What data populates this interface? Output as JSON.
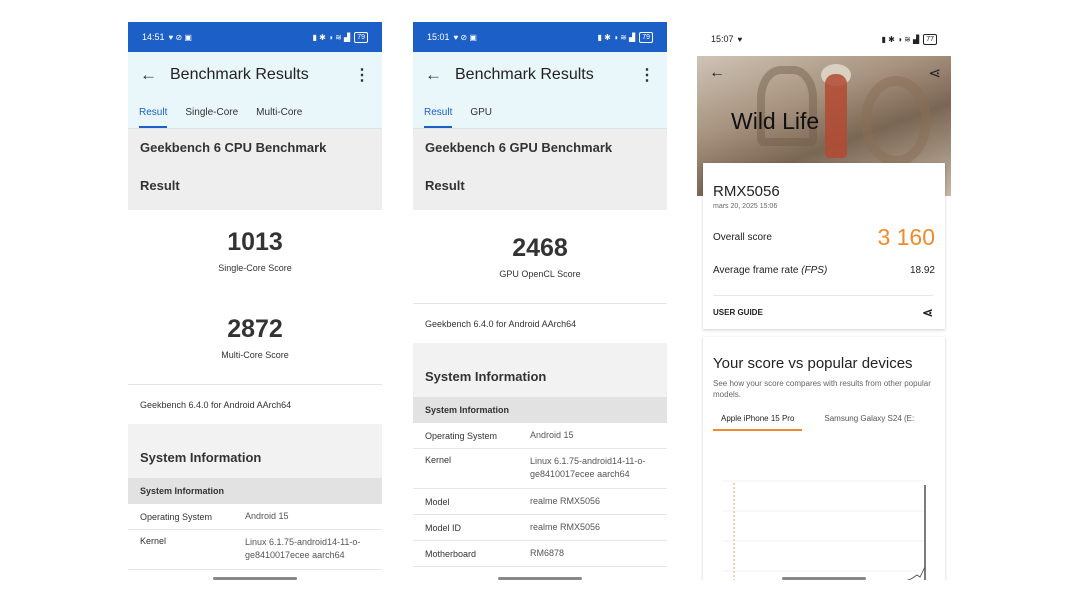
{
  "screen1": {
    "time": "14:51",
    "battery": "79",
    "title": "Benchmark Results",
    "tabs": [
      "Result",
      "Single-Core",
      "Multi-Core"
    ],
    "header": "Geekbench 6 CPU Benchmark",
    "result_label": "Result",
    "scores": [
      {
        "value": "1013",
        "label": "Single-Core Score"
      },
      {
        "value": "2872",
        "label": "Multi-Core Score"
      }
    ],
    "version": "Geekbench 6.4.0 for Android AArch64",
    "sysinfo_title": "System Information",
    "sysinfo_sub": "System Information",
    "rows": [
      {
        "k": "Operating System",
        "v": "Android 15"
      },
      {
        "k": "Kernel",
        "v": "Linux 6.1.75-android14-11-o-ge8410017ecee aarch64"
      }
    ]
  },
  "screen2": {
    "time": "15:01",
    "battery": "79",
    "title": "Benchmark Results",
    "tabs": [
      "Result",
      "GPU"
    ],
    "header": "Geekbench 6 GPU Benchmark",
    "result_label": "Result",
    "score": {
      "value": "2468",
      "label": "GPU OpenCL Score"
    },
    "version": "Geekbench 6.4.0 for Android AArch64",
    "sysinfo_title": "System Information",
    "sysinfo_sub": "System Information",
    "rows": [
      {
        "k": "Operating System",
        "v": "Android 15"
      },
      {
        "k": "Kernel",
        "v": "Linux 6.1.75-android14-11-o-ge8410017ecee aarch64"
      },
      {
        "k": "Model",
        "v": "realme RMX5056"
      },
      {
        "k": "Model ID",
        "v": "realme RMX5056"
      },
      {
        "k": "Motherboard",
        "v": "RM6878"
      }
    ]
  },
  "screen3": {
    "time": "15:07",
    "battery": "77",
    "hero_title": "Wild Life",
    "device": "RMX5056",
    "date": "mars 20, 2025 15:06",
    "overall_label": "Overall score",
    "overall_value": "3 160",
    "fps_label": "Average frame rate",
    "fps_unit": "(FPS)",
    "fps_value": "18.92",
    "user_guide": "USER GUIDE",
    "compare_title": "Your score vs popular devices",
    "compare_desc": "See how your score compares with results from other popular models.",
    "compare_tabs": [
      "Apple iPhone 15 Pro",
      "Samsung Galaxy S24 (E:"
    ]
  },
  "colors": {
    "blue": "#1c5fc6",
    "orange": "#f08a2b",
    "appbar": "#e9f6fa"
  }
}
